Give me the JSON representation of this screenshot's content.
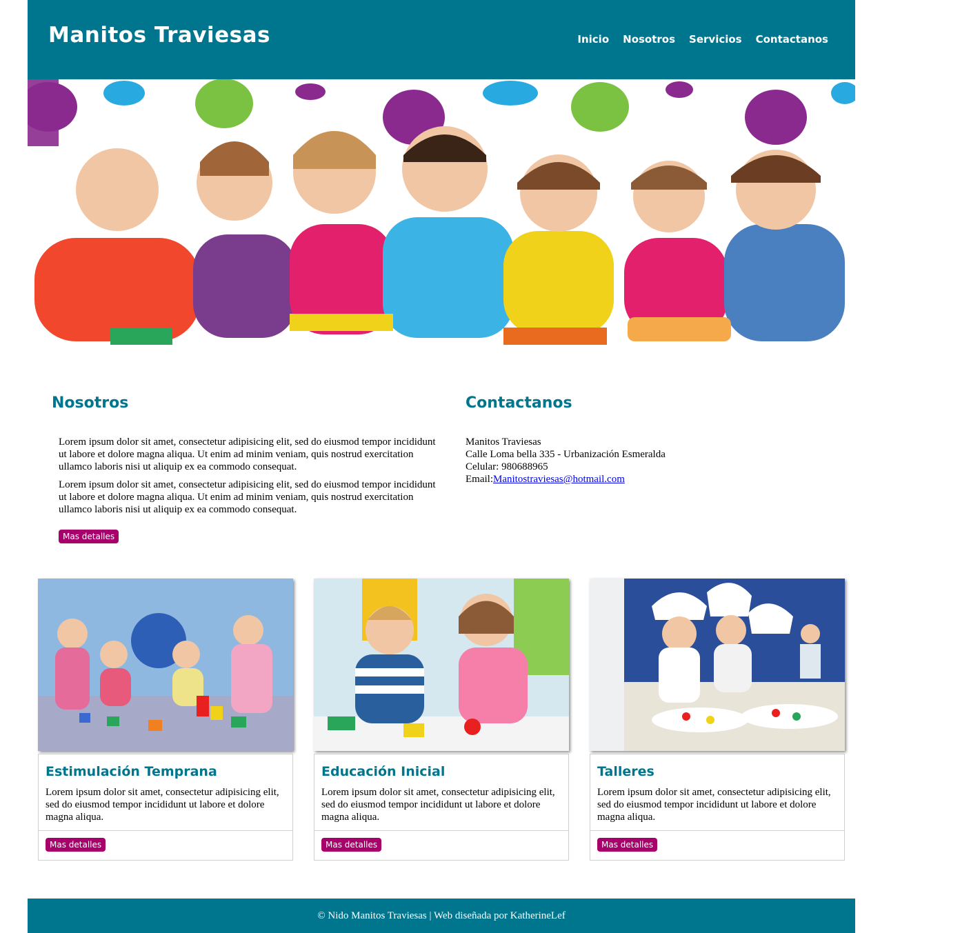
{
  "header": {
    "brand": "Manitos Traviesas",
    "nav": [
      "Inicio",
      "Nosotros",
      "Servicios",
      "Contactanos"
    ]
  },
  "about": {
    "title": "Nosotros",
    "paragraphs": [
      "Lorem ipsum dolor sit amet, consectetur adipisicing elit, sed do eiusmod tempor incididunt ut labore et dolore magna aliqua. Ut enim ad minim veniam, quis nostrud exercitation ullamco laboris nisi ut aliquip ex ea commodo consequat.",
      "Lorem ipsum dolor sit amet, consectetur adipisicing elit, sed do eiusmod tempor incididunt ut labore et dolore magna aliqua. Ut enim ad minim veniam, quis nostrud exercitation ullamco laboris nisi ut aliquip ex ea commodo consequat."
    ],
    "button": "Mas detalles"
  },
  "contact": {
    "title": "Contactanos",
    "name": "Manitos Traviesas",
    "address": "Calle Loma bella 335 - Urbanización Esmeralda",
    "phone": "Celular: 980688965",
    "email_label": "Email:",
    "email": "Manitostraviesas@hotmail.com"
  },
  "cards": [
    {
      "title": "Estimulación Temprana",
      "text": "Lorem ipsum dolor sit amet, consectetur adipisicing elit, sed do eiusmod tempor incididunt ut labore et dolore magna aliqua.",
      "button": "Mas detalles"
    },
    {
      "title": "Educación Inicial",
      "text": "Lorem ipsum dolor sit amet, consectetur adipisicing elit, sed do eiusmod tempor incididunt ut labore et dolore magna aliqua.",
      "button": "Mas detalles"
    },
    {
      "title": "Talleres",
      "text": "Lorem ipsum dolor sit amet, consectetur adipisicing elit, sed do eiusmod tempor incididunt ut labore et dolore magna aliqua.",
      "button": "Mas detalles"
    }
  ],
  "footer": {
    "text": "© Nido Manitos Traviesas | Web diseñada por KatherineLef"
  },
  "colors": {
    "primary": "#00758e",
    "button": "#a8006b"
  }
}
